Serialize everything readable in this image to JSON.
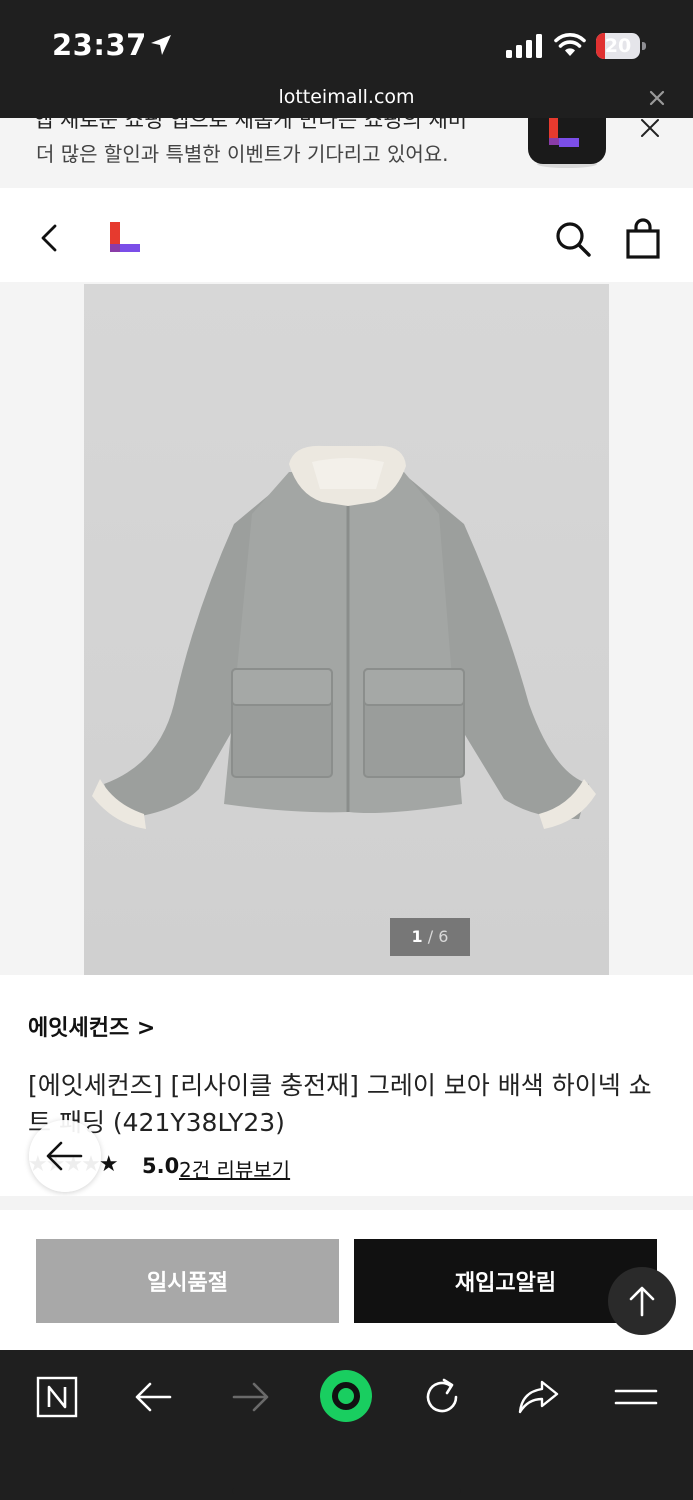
{
  "status_bar": {
    "time": "23:37",
    "battery_level": "20",
    "battery_fraction": 0.2,
    "battery_color": "#e03131"
  },
  "browser": {
    "url": "lotteimall.com",
    "close_icon": "close-icon"
  },
  "promo_banner": {
    "clipped_text": "앱 새로운 쇼핑 앱으로 새롭게 만나는 쇼핑의 재미",
    "subtitle": "더 많은 할인과 특별한 이벤트가 기다리고 있어요.",
    "app_icon": "lotte-app-icon",
    "close_icon": "close-icon"
  },
  "header": {
    "back_icon": "chevron-left-icon",
    "logo_icon": "lotte-logo",
    "search_icon": "search-icon",
    "cart_icon": "shopping-bag-icon"
  },
  "gallery": {
    "image_subject": "grey boa padded jacket",
    "counter_current": "1",
    "counter_total": "/ 6"
  },
  "product": {
    "brand": "에잇세컨즈 >",
    "title": "[에잇세컨즈] [리사이클 충전재] 그레이 보아 배색 하이넥 쇼트 패딩 (421Y38LY23)",
    "stars": "★★★★★",
    "rating_value": 5.0,
    "rating_text": "5.0",
    "review_link": "2건 리뷰보기"
  },
  "purchase_bar": {
    "soldout_label": "일시품절",
    "restock_label": "재입고알림"
  },
  "bottom_toolbar": {
    "icons": [
      "naver-n-icon",
      "arrow-left-icon",
      "arrow-right-icon",
      "green-dot-icon",
      "refresh-icon",
      "share-icon",
      "menu-icon"
    ],
    "accent_color": "#19ce60"
  },
  "colors": {
    "chrome": "#1f1f1f",
    "primary_button": "#111111",
    "disabled_button": "#a8a8a8",
    "logo_red": "#e63a2e",
    "logo_purple": "#7b4ee8"
  }
}
